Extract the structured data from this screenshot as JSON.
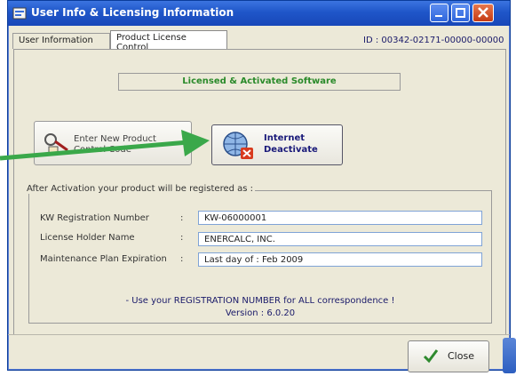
{
  "window": {
    "title": "User Info & Licensing Information"
  },
  "tabs": [
    {
      "label": "User Information"
    },
    {
      "label": "Product License Control"
    }
  ],
  "id_text": "ID : 00342-02171-00000-00000",
  "status": "Licensed & Activated Software",
  "buttons": {
    "enter_line1": "Enter New Product",
    "enter_line2": "Control Code",
    "deact_line1": "Internet",
    "deact_line2": "Deactivate"
  },
  "registration": {
    "group_title": "After Activation your product will be registered as :",
    "rows": [
      {
        "label": "KW Registration Number",
        "colon": ":",
        "value": "KW-06000001"
      },
      {
        "label": "License Holder Name",
        "colon": ":",
        "value": "ENERCALC, INC."
      },
      {
        "label": "Maintenance Plan Expiration",
        "colon": ":",
        "value": "Last day of : Feb 2009"
      }
    ],
    "note": "- Use your REGISTRATION NUMBER for ALL correspondence !",
    "version": "Version : 6.0.20"
  },
  "close_label": "Close",
  "colors": {
    "title_blue": "#1f56c9",
    "status_green": "#2a8a2a",
    "arrow_green": "#3aa84a",
    "close_red": "#c53a13"
  }
}
